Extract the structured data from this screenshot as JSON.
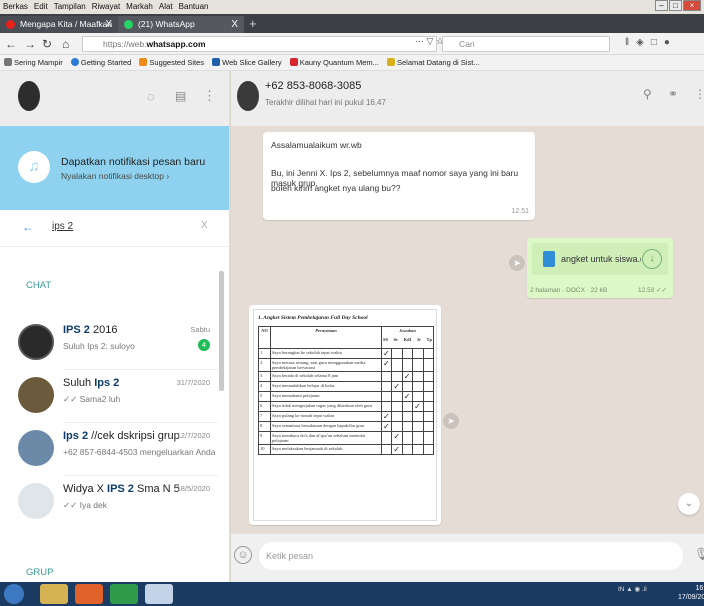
{
  "menubar": {
    "items": [
      "Berkas",
      "Edit",
      "Tampilan",
      "Riwayat",
      "Markah",
      "Alat",
      "Bantuan"
    ]
  },
  "tabs": [
    {
      "title": "Mengapa Kita / Maafkan Aku :",
      "close": "X"
    },
    {
      "title": "(21) WhatsApp",
      "close": "X"
    }
  ],
  "new_tab": "+",
  "url": {
    "prefix": "https://web.",
    "domain": "whatsapp.com",
    "menu": "⋯",
    "search_placeholder": "Cari"
  },
  "bookmarks": [
    {
      "label": "Sering Mampir",
      "color": "#777777"
    },
    {
      "label": "Getting Started",
      "color": "#2b7bd6"
    },
    {
      "label": "Suggested Sites",
      "color": "#f28a18"
    },
    {
      "label": "Web Slice Gallery",
      "color": "#1e5fa8"
    },
    {
      "label": "Kauny Quantum Mem...",
      "color": "#d6252e"
    },
    {
      "label": "Selamat Datang di Sist...",
      "color": "#d8b11c"
    }
  ],
  "notification": {
    "title": "Dapatkan notifikasi pesan baru",
    "subtitle": "Nyalakan notifikasi desktop ›"
  },
  "search": {
    "value": "ips 2",
    "clear": "X"
  },
  "sections": {
    "chat": "CHAT",
    "group": "GRUP"
  },
  "chats": [
    {
      "name_bold": "IPS 2",
      "name_rest": " 2016",
      "preview": "Suluh Ips 2: suloyo",
      "time": "Sabtu",
      "badge": "4",
      "color": "#2a2a2a"
    },
    {
      "name_pre": "Suluh ",
      "name_bold": "Ips 2",
      "preview": "✓✓ Sama2 luh",
      "time": "31/7/2020",
      "color": "#6b5a3c"
    },
    {
      "name_bold": "Ips 2",
      "name_rest": " //cek dskripsi grup",
      "preview": "+62 857-6844-4503 mengeluarkan Anda",
      "time": "12/7/2020",
      "color": "#6a8aa8"
    },
    {
      "name_pre": "Widya X ",
      "name_bold": "IPS 2",
      "name_rest": " Sma N 5",
      "preview": "✓✓ Iya dek",
      "time": "18/5/2020",
      "color": "#dfe5e8"
    }
  ],
  "contact": {
    "name": "+62 853-8068-3085",
    "status": "Terakhir dilihat hari ini pukul 16.47"
  },
  "messages": {
    "m1_lines": [
      "Assalamualaikum wr.wb",
      "Bu, ini Jenni X. Ips 2, sebelumnya maaf nomor saya yang ini baru masuk grup.",
      "boleh kirim angket nya ulang bu??"
    ],
    "m1_time": "12.51",
    "m2_filename": "angket untuk siswa.docx",
    "m2_meta": "2 halaman · DOCX · 22 kB",
    "m2_time": "12.53 ✓✓"
  },
  "document": {
    "title": "1. Angket Sistem Pembelajaran Full Day School",
    "headers": {
      "no": "NO",
      "statement": "Pernyataan",
      "answer": "Jawaban",
      "options": [
        "SS",
        "Sr",
        "KdI",
        "Jr",
        "Tp"
      ]
    },
    "rows": [
      {
        "no": "1",
        "text": "Saya berangkat ke sekolah tepat waktu",
        "check": 0
      },
      {
        "no": "2",
        "text": "Saya merasa senang, saat guru menggunakan media pembelajaran bervariasi",
        "check": 0
      },
      {
        "no": "3",
        "text": "Saya berada di sekolah selama 8 jam",
        "check": 2
      },
      {
        "no": "4",
        "text": "Saya memudahkan belajar di kelas",
        "check": 1
      },
      {
        "no": "5",
        "text": "Saya memahami pelajaran",
        "check": 2
      },
      {
        "no": "6",
        "text": "Saya tidak mengerjakan tugas yang diberikan oleh guru",
        "check": 3
      },
      {
        "no": "7",
        "text": "Saya pulang ke rumah tepat waktu",
        "check": 0
      },
      {
        "no": "8",
        "text": "Saya senantiasa bersalaman dengan bapak/ibu guru",
        "check": 0
      },
      {
        "no": "9",
        "text": "Saya membaca do'a dan al-qur'an sebelum memulai pelajaran",
        "check": 1
      },
      {
        "no": "10",
        "text": "Saya melaksakan berjamaah di sekolah",
        "check": 1
      }
    ]
  },
  "composer": {
    "placeholder": "Ketik pesan"
  },
  "taskbar": {
    "time": "16:54",
    "date": "17/09/2020"
  }
}
